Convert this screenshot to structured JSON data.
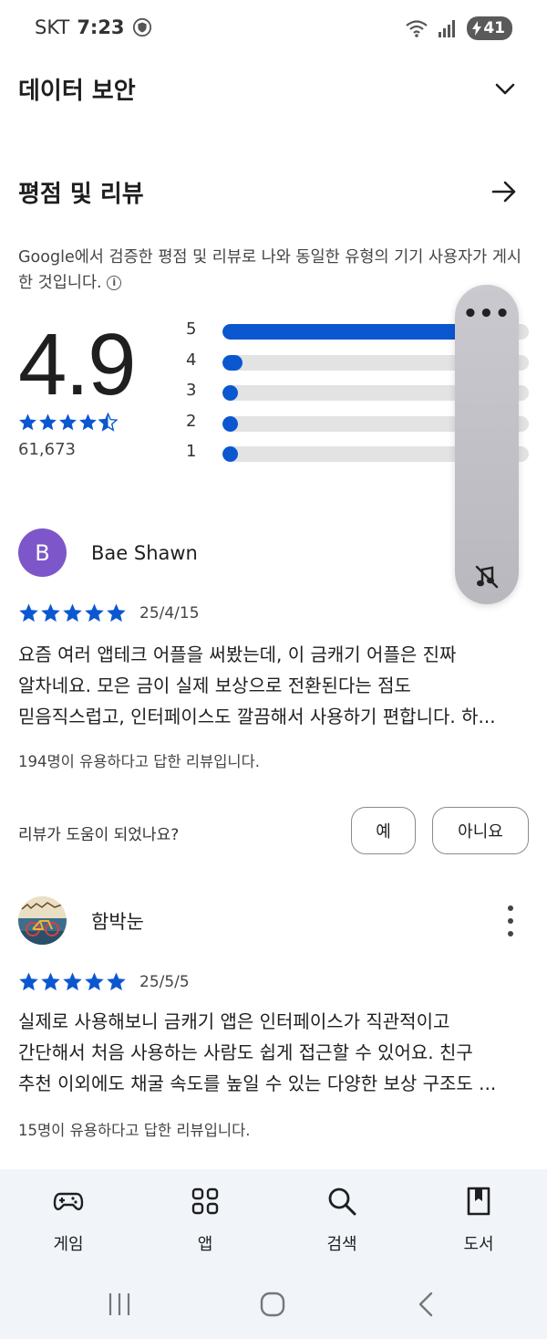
{
  "status_bar": {
    "carrier": "SKT",
    "time": "7:23",
    "battery": "41"
  },
  "data_security": {
    "title": "데이터 보안"
  },
  "ratings_reviews": {
    "title": "평점 및 리뷰",
    "description": "Google에서 검증한 평점 및 리뷰로 나와 동일한 유형의 기기 사용자가 게시한 것입니다.",
    "average": "4.9",
    "stars_value": 4.5,
    "count": "61,673",
    "distribution": [
      {
        "label": "5",
        "fraction": 0.93
      },
      {
        "label": "4",
        "fraction": 0.065
      },
      {
        "label": "3",
        "fraction": 0.045
      },
      {
        "label": "2",
        "fraction": 0.045
      },
      {
        "label": "1",
        "fraction": 0.045
      }
    ]
  },
  "reviews": [
    {
      "avatar_letter": "B",
      "name": "Bae Shawn",
      "stars": 5,
      "date": "25/4/15",
      "lines": [
        "요즘 여러 앱테크 어플을 써봤는데, 이 금캐기 어플은 진짜",
        "알차네요. 모은 금이 실제 보상으로 전환된다는 점도",
        "믿음직스럽고, 인터페이스도 깔끔해서 사용하기 편합니다. 하..."
      ],
      "helpful": "194명이 유용하다고 답한 리뷰입니다.",
      "helpful_question": "리뷰가 도움이 되었나요?",
      "yes_label": "예",
      "no_label": "아니요"
    },
    {
      "name": "함박눈",
      "stars": 5,
      "date": "25/5/5",
      "lines": [
        "실제로 사용해보니 금캐기 앱은 인터페이스가 직관적이고",
        "간단해서 처음 사용하는 사람도 쉽게 접근할 수 있어요. 친구",
        "추천 이외에도 채굴 속도를 높일 수 있는 다양한 보상 구조도 ..."
      ],
      "helpful": "15명이 유용하다고 답한 리뷰입니다."
    }
  ],
  "bottom_nav": [
    {
      "label": "게임",
      "icon": "gamepad-icon"
    },
    {
      "label": "앱",
      "icon": "apps-grid-icon"
    },
    {
      "label": "검색",
      "icon": "search-icon"
    },
    {
      "label": "도서",
      "icon": "book-icon"
    }
  ],
  "colors": {
    "accent": "#0b57d0",
    "avatar": "#7d56c9",
    "nav_bg": "#f1f4f9"
  }
}
